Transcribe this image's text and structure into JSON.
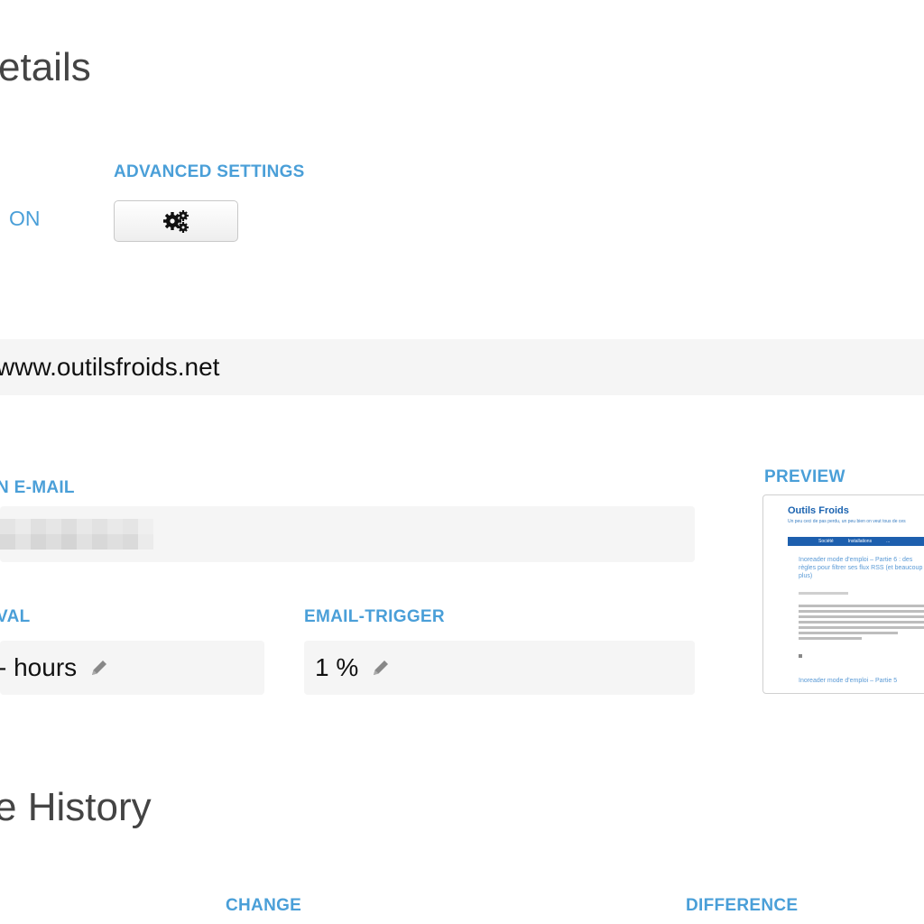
{
  "section_details": {
    "title": "etails"
  },
  "advanced_settings": {
    "label": "ADVANCED SETTINGS",
    "gear_icon": "gears-icon"
  },
  "status": {
    "value": "ON"
  },
  "url": {
    "value": "www.outilsfroids.net"
  },
  "notification_email": {
    "label": "N E-MAIL"
  },
  "preview": {
    "label": "PREVIEW",
    "site_title": "Outils Froids",
    "site_tagline": "Un peu ceci de pas perdu, un peu bien on veut tous de ces",
    "nav": [
      "Société",
      "Installations",
      "..."
    ],
    "post_title_1": "Inoreader mode d'emploi – Partie 6 : des règles pour filtrer ses flux RSS (et beaucoup plus)",
    "post_title_2": "Inoreader mode d'emploi – Partie 5"
  },
  "interval": {
    "label": "VAL",
    "value": "- hours"
  },
  "email_trigger": {
    "label": "EMAIL-TRIGGER",
    "value": "1 %"
  },
  "section_history": {
    "title": "e History"
  },
  "history_table": {
    "columns": [
      "CHANGE",
      "DIFFERENCE"
    ]
  },
  "colors": {
    "accent": "#4a9fd8",
    "field_bg": "#f5f5f5",
    "heading": "#444444"
  }
}
